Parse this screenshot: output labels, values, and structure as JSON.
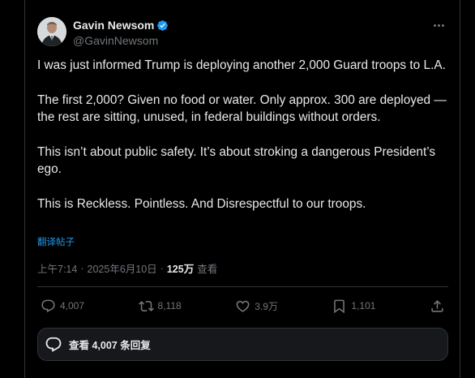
{
  "author": {
    "name": "Gavin Newsom",
    "handle": "@GavinNewsom",
    "verified_color": "#1d9bf0"
  },
  "tweet": {
    "paragraphs": [
      "I was just informed Trump is deploying another 2,000 Guard troops to L.A.",
      "The first 2,000? Given no food or water. Only approx. 300 are deployed — the rest are sitting, unused, in federal buildings without orders.",
      "This isn’t about public safety. It’s about stroking a dangerous President’s ego.",
      "This is Reckless. Pointless. And Disrespectful to our troops."
    ],
    "translate_label": "翻译帖子"
  },
  "meta": {
    "time": "上午7:14",
    "separator": "·",
    "date": "2025年6月10日",
    "views_count": "125万",
    "views_label": "查看"
  },
  "actions": {
    "replies": "4,007",
    "reposts": "8,118",
    "likes": "3.9万",
    "bookmarks": "1,101"
  },
  "replies_button": {
    "label": "查看 4,007 条回复"
  },
  "colors": {
    "background": "#000000",
    "text": "#e7e9ea",
    "muted": "#71767b",
    "accent": "#1d9bf0",
    "border": "#2f3336"
  },
  "icons": [
    "verified-badge-icon",
    "more-icon",
    "reply-icon",
    "repost-icon",
    "like-icon",
    "bookmark-icon",
    "share-icon",
    "chat-bubble-icon"
  ]
}
